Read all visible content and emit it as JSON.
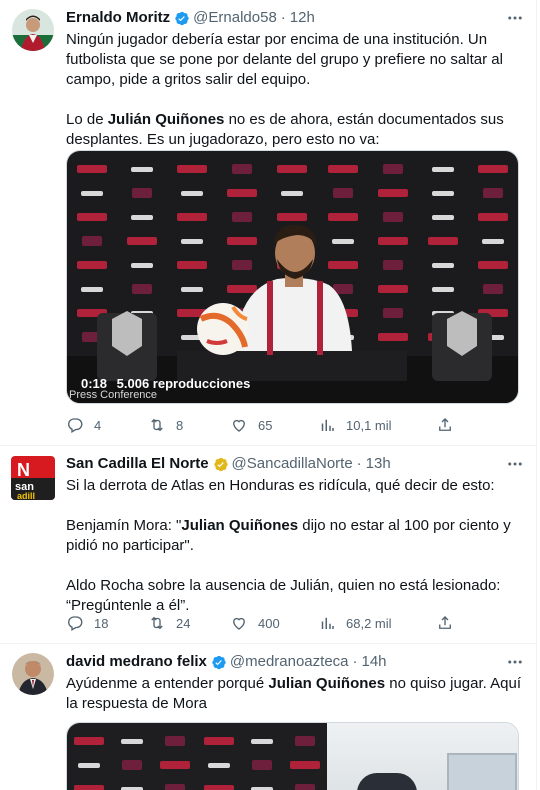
{
  "colors": {
    "verified_blue": "#1d9bf0",
    "verified_gold": "#e2b719",
    "secondary_text": "#536471",
    "divider": "#eff3f4"
  },
  "tweets": [
    {
      "name": "Ernaldo Moritz",
      "badge": "verified-blue-icon",
      "handle": "@Ernaldo58",
      "dot": "·",
      "time": "12h",
      "p1": "Ningún jugador debería estar por encima de una institución. Un futbolista que se pone por delante del grupo y prefiere no saltar al campo, pide a gritos salir del equipo.",
      "p2_pre": "Lo de ",
      "p2_bold": "Julián Quiñones",
      "p2_post": " no es de ahora, están documentados sus desplantes. Es un jugadorazo, pero esto no va:",
      "video": {
        "duration": "0:18",
        "views": "5.006 reproducciones",
        "caption": "Press Conference"
      },
      "replies": "4",
      "retweets": "8",
      "likes": "65",
      "views": "10,1 mil"
    },
    {
      "name": "San Cadilla El Norte",
      "badge": "verified-gold-icon",
      "handle": "@SancadillaNorte",
      "dot": "·",
      "time": "13h",
      "p1": "Si la derrota de Atlas en Honduras es ridícula, qué decir de esto:",
      "p2_pre": "Benjamín Mora: \"",
      "p2_bold": "Julian Quiñones",
      "p2_post": " dijo no estar al 100 por ciento y pidió no participar\".",
      "p3": "Aldo Rocha sobre la ausencia de Julián, quien no está lesionado: “Pregúntenle a él”.",
      "replies": "18",
      "retweets": "24",
      "likes": "400",
      "views": "68,2 mil"
    },
    {
      "name": "david medrano felix",
      "badge": "verified-blue-icon",
      "handle": "@medranoazteca",
      "dot": "·",
      "time": "14h",
      "p1_pre": "Ayúdenme a entender porqué ",
      "p1_bold": "Julian Quiñones",
      "p1_post": " no quiso jugar. Aquí la respuesta de Mora"
    }
  ]
}
